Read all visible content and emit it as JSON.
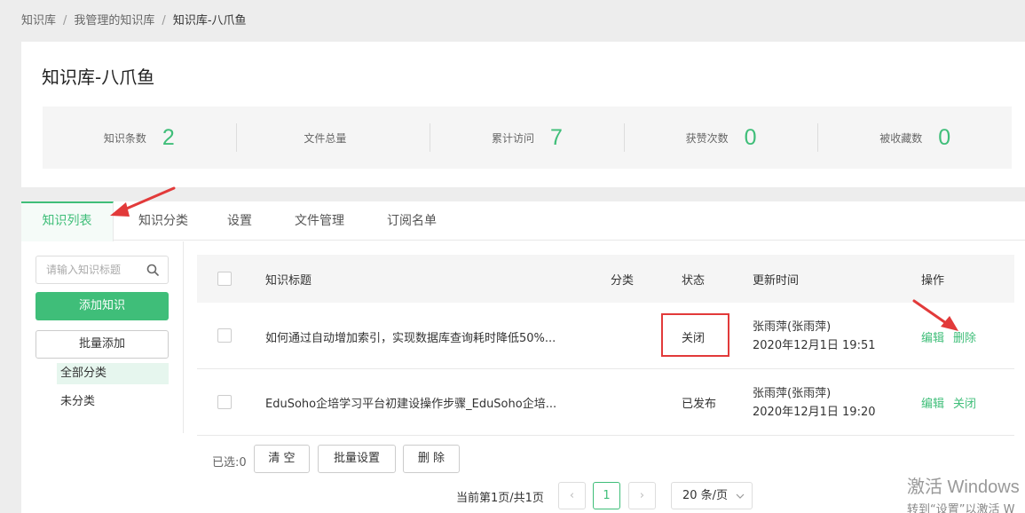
{
  "breadcrumb": {
    "items": [
      "知识库",
      "我管理的知识库",
      "知识库-八爪鱼"
    ],
    "separator": "/"
  },
  "knowledge_base": {
    "title": "知识库-八爪鱼"
  },
  "stats": [
    {
      "label": "知识条数",
      "value": "2"
    },
    {
      "label": "文件总量",
      "value": ""
    },
    {
      "label": "累计访问",
      "value": "7"
    },
    {
      "label": "获赞次数",
      "value": "0"
    },
    {
      "label": "被收藏数",
      "value": "0"
    }
  ],
  "tabs": [
    {
      "label": "知识列表",
      "active": true
    },
    {
      "label": "知识分类",
      "active": false
    },
    {
      "label": "设置",
      "active": false
    },
    {
      "label": "文件管理",
      "active": false
    },
    {
      "label": "订阅名单",
      "active": false
    }
  ],
  "sidebar": {
    "search_placeholder": "请输入知识标题",
    "add_label": "添加知识",
    "batch_add_label": "批量添加",
    "categories": [
      {
        "label": "全部分类",
        "active": true
      },
      {
        "label": "未分类",
        "active": false
      }
    ]
  },
  "table": {
    "columns": {
      "title": "知识标题",
      "category": "分类",
      "status": "状态",
      "updated": "更新时间",
      "actions": "操作"
    },
    "rows": [
      {
        "title": "如何通过自动增加索引，实现数据库查询耗时降低50%...",
        "category": "",
        "status": "关闭",
        "updater": "张雨萍(张雨萍)",
        "updated_at": "2020年12月1日 19:51",
        "action_edit": "编辑",
        "action_2": "删除"
      },
      {
        "title": "EduSoho企培学习平台初建设操作步骤_EduSoho企培...",
        "category": "",
        "status": "已发布",
        "updater": "张雨萍(张雨萍)",
        "updated_at": "2020年12月1日 19:20",
        "action_edit": "编辑",
        "action_2": "关闭"
      }
    ]
  },
  "footer": {
    "selected_label": "已选:0",
    "clear_label": "清 空",
    "batch_settings_label": "批量设置",
    "delete_label": "删 除"
  },
  "pagination": {
    "info": "当前第1页/共1页",
    "prev": "‹",
    "current": "1",
    "next": "›",
    "page_size": "20 条/页"
  },
  "watermark": {
    "line1": "激活 Windows",
    "line2": "转到“设置”以激活 W"
  },
  "colors": {
    "accent": "#3fbe79",
    "highlight": "#e23a3a"
  }
}
